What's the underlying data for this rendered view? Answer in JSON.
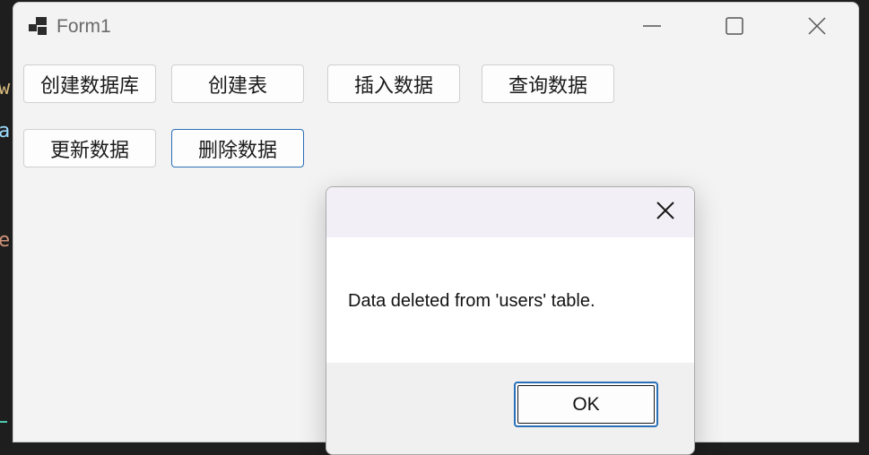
{
  "background_editor": {
    "glyphs": [
      "w",
      "a",
      "e:"
    ]
  },
  "window": {
    "title": "Form1",
    "icons": {
      "app": "app-icon",
      "minimize": "minimize-icon",
      "maximize": "maximize-icon",
      "close": "close-icon"
    }
  },
  "form": {
    "buttons": {
      "create_db": "创建数据库",
      "create_table": "创建表",
      "insert": "插入数据",
      "query": "查询数据",
      "update": "更新数据",
      "delete": "删除数据"
    }
  },
  "messagebox": {
    "message": "Data deleted from 'users' table.",
    "ok_label": "OK"
  },
  "colors": {
    "window_bg": "#f3f3f3",
    "focus_border": "#2a70b8",
    "msg_title_bg": "#f3eff6",
    "msg_footer_bg": "#f0f0f0"
  }
}
